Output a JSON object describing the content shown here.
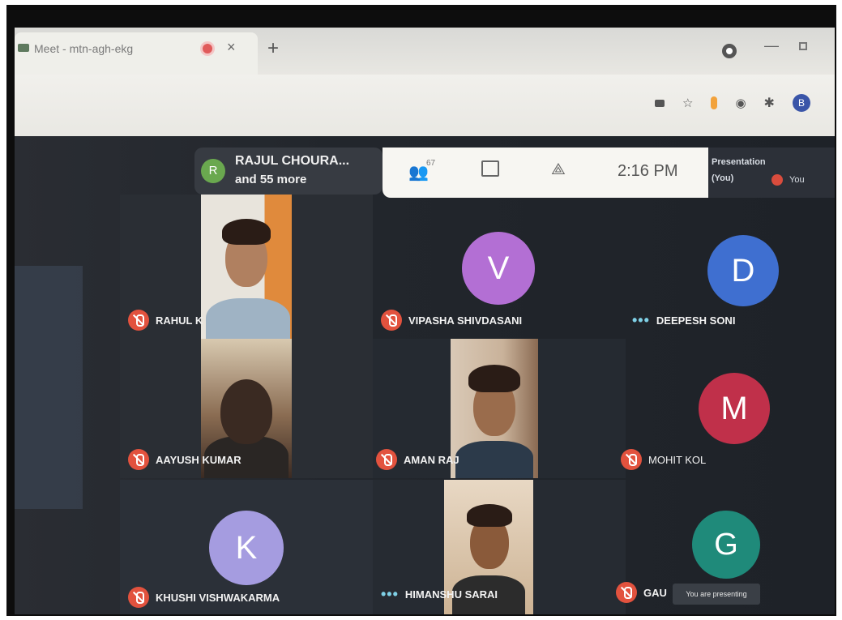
{
  "browser": {
    "tab_title": "Meet - mtn-agh-ekg",
    "tab_close": "×",
    "new_tab": "+",
    "minimize": "—",
    "profile_initial": "B"
  },
  "meet": {
    "host": {
      "initial": "R",
      "name": "RAJUL CHOURA...",
      "more": "and 55 more"
    },
    "participants_count": "67",
    "time": "2:16 PM",
    "presentation": {
      "label": "Presentation",
      "you_tag": "(You)",
      "you": "You"
    },
    "presenting_toast": "You are presenting",
    "tiles": [
      {
        "name": "RAHUL K",
        "type": "video"
      },
      {
        "name": "VIPASHA SHIVDASANI",
        "type": "avatar",
        "initial": "V",
        "color": "#b36fd4"
      },
      {
        "name": "DEEPESH SONI",
        "type": "avatar",
        "initial": "D",
        "color": "#3f6fd0"
      },
      {
        "name": "AAYUSH KUMAR",
        "type": "video"
      },
      {
        "name": "AMAN RAJ",
        "type": "video"
      },
      {
        "name": "MOHIT KOL",
        "type": "avatar",
        "initial": "M",
        "color": "#c0304a"
      },
      {
        "name": "KHUSHI VISHWAKARMA",
        "type": "avatar",
        "initial": "K",
        "color": "#a59ce0"
      },
      {
        "name": "HIMANSHU SARAI",
        "type": "video"
      },
      {
        "name": "GAU",
        "type": "avatar",
        "initial": "G",
        "color": "#1f8a7a"
      }
    ]
  }
}
